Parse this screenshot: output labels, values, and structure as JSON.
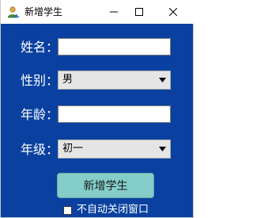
{
  "window": {
    "title": "新增学生",
    "controls": {
      "minimize": "minimize",
      "maximize": "maximize",
      "close": "close"
    }
  },
  "form": {
    "name": {
      "label": "姓名：",
      "value": ""
    },
    "gender": {
      "label": "性别：",
      "selected": "男"
    },
    "age": {
      "label": "年龄：",
      "value": ""
    },
    "grade": {
      "label": "年级：",
      "selected": "初一"
    }
  },
  "actions": {
    "add_label": "新增学生",
    "no_autoclose_label": "不自动关闭窗口",
    "no_autoclose_checked": false
  },
  "colors": {
    "background": "#0a41a0",
    "button": "#84cdc8",
    "text": "#ffffff"
  },
  "icons": {
    "app": "user-icon",
    "dropdown": "chevron-down-icon"
  }
}
